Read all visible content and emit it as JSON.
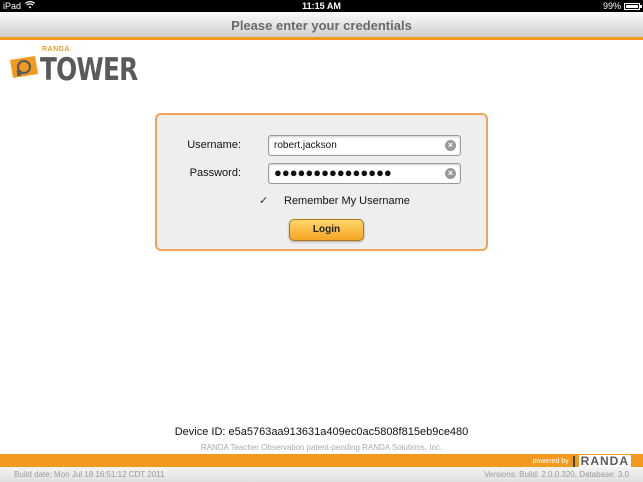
{
  "status": {
    "carrier": "iPad",
    "time": "11:15 AM",
    "battery": "99%",
    "battery_level": 0.99
  },
  "header": {
    "title": "Please enter your credentials"
  },
  "logo": {
    "brand_small": "RANDA",
    "product": "TOWER"
  },
  "form": {
    "username_label": "Username:",
    "username_value": "robert.jackson",
    "password_label": "Password:",
    "password_value": "●●●●●●●●●●●●●●●",
    "remember_label": "Remember My Username",
    "remember_checked": true,
    "login_label": "Login"
  },
  "device": {
    "id_text": "Device ID: e5a5763aa913631a409ec0ac5808f815eb9ce480"
  },
  "footer": {
    "patent": "RANDA Teacher Observation patent-pending RANDA Solutions, Inc.",
    "build_date": "Build date: Mon Jul 18 16:51:12 CDT 2011",
    "versions": "Versions: Build: 2.0.0.320, Database: 3.0",
    "powered_by": "powered by",
    "brand": "RANDA"
  },
  "colors": {
    "accent": "#f39a1e",
    "panel_border": "#f0a45a"
  }
}
